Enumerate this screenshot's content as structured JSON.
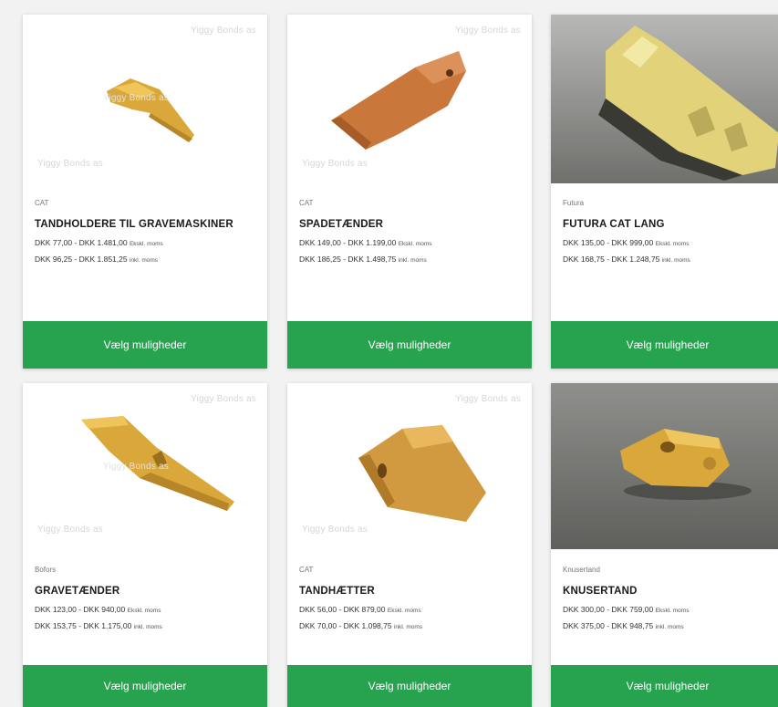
{
  "watermark": "Yiggy Bonds as",
  "button_label": "Vælg muligheder",
  "products": [
    {
      "brand": "CAT",
      "title": "TANDHOLDERE TIL GRAVEMASKINER",
      "price_excl": "DKK 77,00 - DKK 1.481,00",
      "price_excl_note": "Ekskl. moms",
      "price_incl": "DKK 96,25 - DKK 1.851,25",
      "price_incl_note": "inkl. moms",
      "image": "tooth-holder-icon"
    },
    {
      "brand": "CAT",
      "title": "SPADETÆNDER",
      "price_excl": "DKK 149,00 - DKK 1.199,00",
      "price_excl_note": "Ekskl. moms",
      "price_incl": "DKK 186,25 - DKK 1.498,75",
      "price_incl_note": "inkl. moms",
      "image": "spade-tooth-icon"
    },
    {
      "brand": "Futura",
      "title": "FUTURA CAT LANG",
      "price_excl": "DKK 135,00 - DKK 999,00",
      "price_excl_note": "Ekskl. moms",
      "price_incl": "DKK 168,75 - DKK 1.248,75",
      "price_incl_note": "inkl. moms",
      "image": "futura-tooth-photo"
    },
    {
      "brand": "Bofors",
      "title": "GRAVETÆNDER",
      "price_excl": "DKK 123,00 - DKK 940,00",
      "price_excl_note": "Ekskl. moms",
      "price_incl": "DKK 153,75 - DKK 1.175,00",
      "price_incl_note": "inkl. moms",
      "image": "digging-tooth-icon"
    },
    {
      "brand": "CAT",
      "title": "TANDHÆTTER",
      "price_excl": "DKK 56,00 - DKK 879,00",
      "price_excl_note": "Ekskl. moms",
      "price_incl": "DKK 70,00 - DKK 1.098,75",
      "price_incl_note": "inkl. moms",
      "image": "tooth-cap-icon"
    },
    {
      "brand": "Knusertand",
      "title": "KNUSERTAND",
      "price_excl": "DKK 300,00 - DKK 759,00",
      "price_excl_note": "Ekskl. moms",
      "price_incl": "DKK 375,00 - DKK 948,75",
      "price_incl_note": "inkl. moms",
      "image": "crusher-tooth-photo"
    }
  ],
  "colors": {
    "button": "#27a24e",
    "tooth_yellow": "#d9a73a",
    "tooth_orange": "#c9773a"
  }
}
